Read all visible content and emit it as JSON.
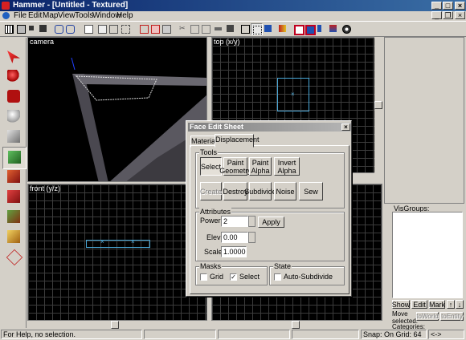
{
  "window": {
    "title": "Hammer - [Untitled - Textured]",
    "controls": {
      "minimize": "_",
      "maximize": "□",
      "close": "×"
    }
  },
  "menubar": {
    "items": [
      "File",
      "Edit",
      "Map",
      "View",
      "Tools",
      "Window",
      "Help"
    ],
    "doc_controls": {
      "minimize": "_",
      "restore": "❐",
      "close": "×"
    }
  },
  "views": {
    "camera": {
      "label": "camera"
    },
    "top": {
      "label": "top (x/y)"
    },
    "front": {
      "label": "front (y/z)"
    }
  },
  "dialog": {
    "title": "Face Edit Sheet",
    "tabs": [
      "Material",
      "Displacement"
    ],
    "active_tab": "Displacement",
    "tools_group": "Tools",
    "tools_row1": [
      "Select",
      "Paint Geometry",
      "Paint Alpha",
      "Invert Alpha"
    ],
    "tools_row2": [
      "Create",
      "Destroy",
      "Subdivide",
      "Noise",
      "Sew"
    ],
    "attributes_group": "Attributes",
    "power_label": "Power",
    "power_value": "2",
    "elev_label": "Elev",
    "elev_value": "0.00",
    "scale_label": "Scale",
    "scale_value": "1.0000",
    "apply_label": "Apply",
    "masks_group": "Masks",
    "mask_grid": {
      "label": "Grid",
      "checked": false
    },
    "mask_select": {
      "label": "Select",
      "checked": true
    },
    "state_group": "State",
    "auto_subdivide": {
      "label": "Auto-Subdivide",
      "checked": false
    },
    "check_mark": "✓"
  },
  "right_panel": {
    "visgroups_label": "VisGroups:",
    "buttons": [
      "Show",
      "Edit",
      "Mark"
    ],
    "arrow_up": "↑",
    "arrow_down": "↓",
    "move_selected_label": "Move selected:",
    "to_world_label": "toWorld",
    "to_entity_label": "toEntity",
    "categories_label": "Categories:"
  },
  "statusbar": {
    "help": "For Help, no selection.",
    "snap": "Snap: On Grid: 64",
    "extra": "<->"
  },
  "colors": {
    "title_active": "#0a246a",
    "title_inactive": "#808080",
    "selection_outline": "#4aa8d8",
    "grid_line": "#3c3c3c",
    "face": "#d4d0c8"
  },
  "icons": {
    "toolbar": [
      "grid-icon",
      "grid-icon",
      "grid-icon",
      "grid-icon",
      "undo-icon",
      "undo-icon",
      "copy-icon",
      "paste-icon",
      "group-icon",
      "ungroup-icon",
      "ignore-group-icon",
      "hide-icon",
      "cut-icon",
      "carve-icon",
      "hollow-icon",
      "texture-lock-icon",
      "selection-icon",
      "door-icon",
      "paint-icon",
      "apply-icon",
      "run-icon",
      "compile-icon",
      "help-icon"
    ],
    "palette": [
      "pointer-tool-icon",
      "magnify-tool-icon",
      "camera-tool-icon",
      "entity-tool-icon",
      "block-tool-icon",
      "texture-application-icon",
      "apply-texture-icon",
      "decal-tool-icon",
      "overlay-tool-icon",
      "clipping-tool-icon",
      "vertex-tool-icon"
    ]
  }
}
